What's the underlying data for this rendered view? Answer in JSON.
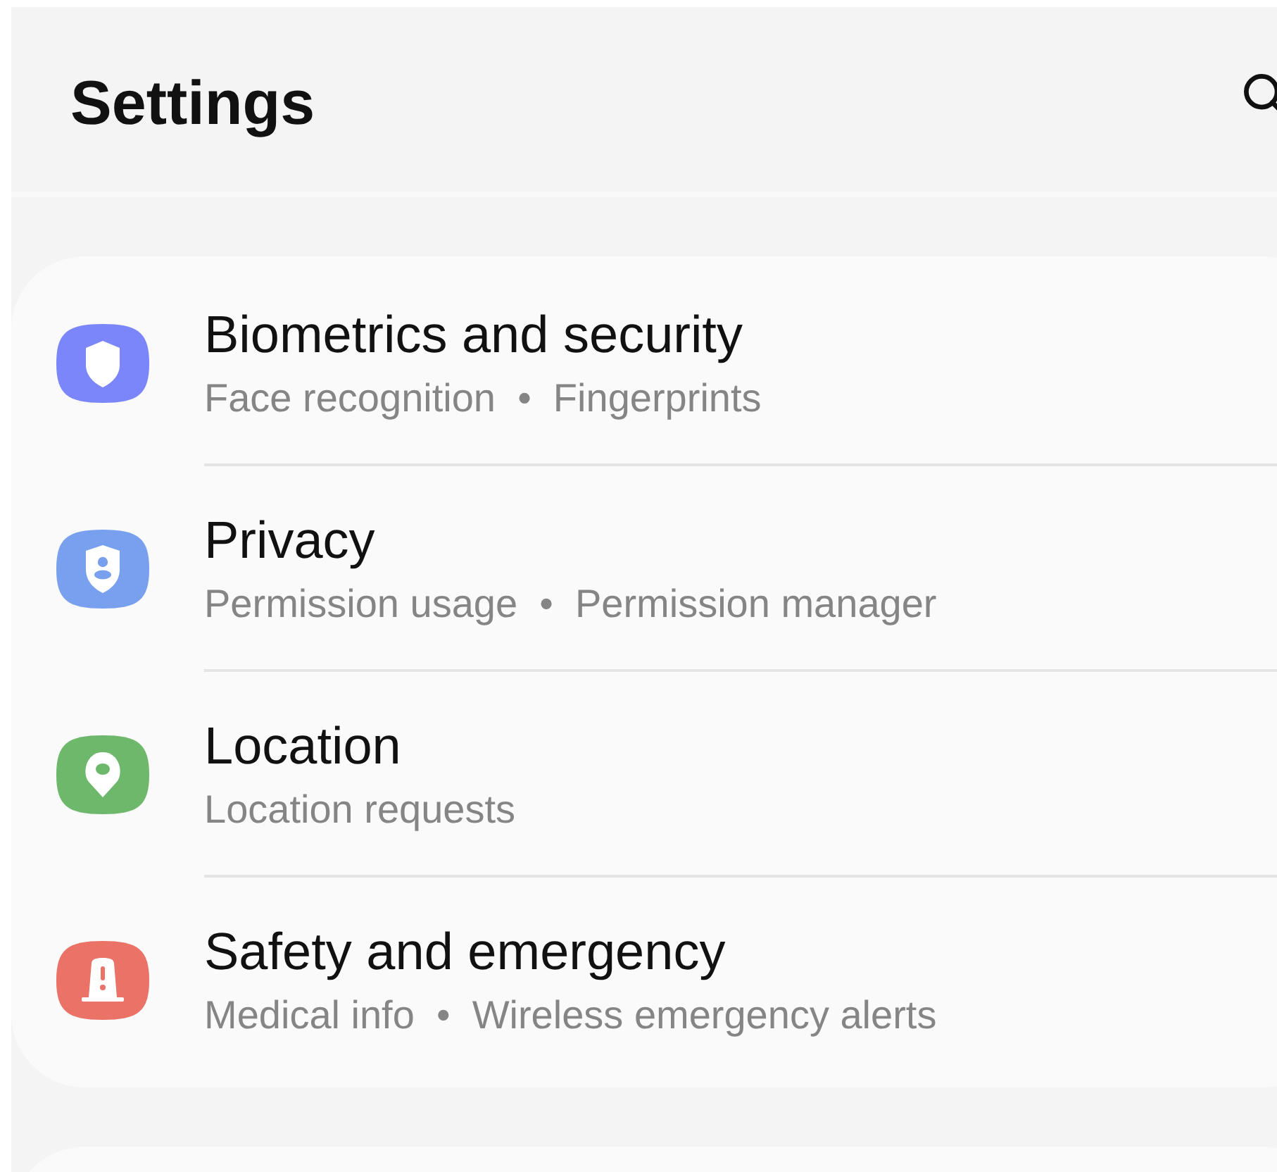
{
  "header": {
    "title": "Settings"
  },
  "items": [
    {
      "kind": "shield",
      "color": "#7b86fb",
      "title": "Biometrics and security",
      "subtitle": "Face recognition  •  Fingerprints"
    },
    {
      "kind": "privacy",
      "color": "#79a0ee",
      "title": "Privacy",
      "subtitle": "Permission usage  •  Permission manager"
    },
    {
      "kind": "location",
      "color": "#6db86a",
      "title": "Location",
      "subtitle": "Location requests"
    },
    {
      "kind": "safety",
      "color": "#eb7266",
      "title": "Safety and emergency",
      "subtitle": "Medical info  •  Wireless emergency alerts"
    }
  ]
}
